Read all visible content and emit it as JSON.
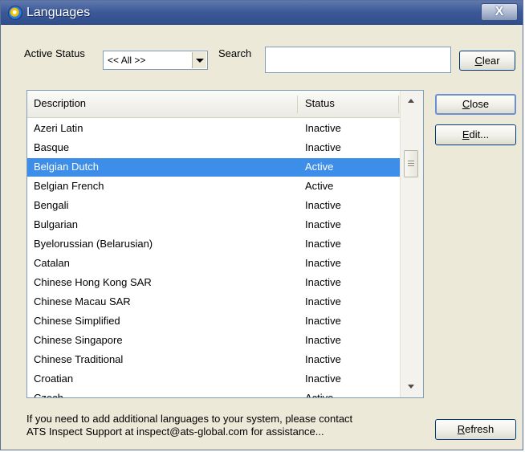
{
  "window": {
    "title": "Languages",
    "close_glyph": "X"
  },
  "filters": {
    "active_status_label": "Active Status",
    "active_status_value": "<< All >>",
    "search_label": "Search",
    "search_value": ""
  },
  "buttons": {
    "clear": {
      "mnemonic": "C",
      "rest": "lear"
    },
    "close": {
      "mnemonic": "C",
      "rest": "lose"
    },
    "edit": {
      "mnemonic": "E",
      "rest": "dit..."
    },
    "refresh": {
      "mnemonic": "R",
      "rest": "efresh"
    }
  },
  "list": {
    "columns": [
      "Description",
      "Status"
    ],
    "selected_index": 2,
    "rows": [
      {
        "description": "Azeri Latin",
        "status": "Inactive"
      },
      {
        "description": "Basque",
        "status": "Inactive"
      },
      {
        "description": "Belgian Dutch",
        "status": "Active"
      },
      {
        "description": "Belgian French",
        "status": "Active"
      },
      {
        "description": "Bengali",
        "status": "Inactive"
      },
      {
        "description": "Bulgarian",
        "status": "Inactive"
      },
      {
        "description": "Byelorussian (Belarusian)",
        "status": "Inactive"
      },
      {
        "description": "Catalan",
        "status": "Inactive"
      },
      {
        "description": "Chinese Hong Kong SAR",
        "status": "Inactive"
      },
      {
        "description": "Chinese Macau SAR",
        "status": "Inactive"
      },
      {
        "description": "Chinese Simplified",
        "status": "Inactive"
      },
      {
        "description": "Chinese Singapore",
        "status": "Inactive"
      },
      {
        "description": "Chinese Traditional",
        "status": "Inactive"
      },
      {
        "description": "Croatian",
        "status": "Inactive"
      },
      {
        "description": "Czech",
        "status": "Active"
      }
    ]
  },
  "info": {
    "line1": "If you need to add additional languages to your system, please contact",
    "line2": "ATS Inspect Support at inspect@ats-global.com for assistance..."
  },
  "colors": {
    "selection": "#3d8ee8",
    "titlebar": "#3d5a98",
    "dialog_bg": "#ece9d8"
  }
}
